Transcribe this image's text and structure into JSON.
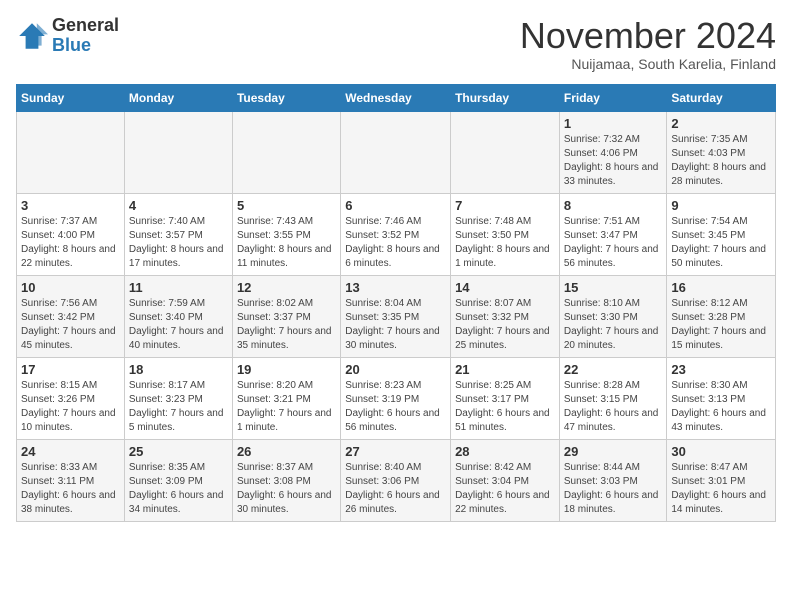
{
  "logo": {
    "general": "General",
    "blue": "Blue"
  },
  "title": "November 2024",
  "subtitle": "Nuijamaa, South Karelia, Finland",
  "days_of_week": [
    "Sunday",
    "Monday",
    "Tuesday",
    "Wednesday",
    "Thursday",
    "Friday",
    "Saturday"
  ],
  "weeks": [
    [
      {
        "day": "",
        "info": ""
      },
      {
        "day": "",
        "info": ""
      },
      {
        "day": "",
        "info": ""
      },
      {
        "day": "",
        "info": ""
      },
      {
        "day": "",
        "info": ""
      },
      {
        "day": "1",
        "info": "Sunrise: 7:32 AM\nSunset: 4:06 PM\nDaylight: 8 hours and 33 minutes."
      },
      {
        "day": "2",
        "info": "Sunrise: 7:35 AM\nSunset: 4:03 PM\nDaylight: 8 hours and 28 minutes."
      }
    ],
    [
      {
        "day": "3",
        "info": "Sunrise: 7:37 AM\nSunset: 4:00 PM\nDaylight: 8 hours and 22 minutes."
      },
      {
        "day": "4",
        "info": "Sunrise: 7:40 AM\nSunset: 3:57 PM\nDaylight: 8 hours and 17 minutes."
      },
      {
        "day": "5",
        "info": "Sunrise: 7:43 AM\nSunset: 3:55 PM\nDaylight: 8 hours and 11 minutes."
      },
      {
        "day": "6",
        "info": "Sunrise: 7:46 AM\nSunset: 3:52 PM\nDaylight: 8 hours and 6 minutes."
      },
      {
        "day": "7",
        "info": "Sunrise: 7:48 AM\nSunset: 3:50 PM\nDaylight: 8 hours and 1 minute."
      },
      {
        "day": "8",
        "info": "Sunrise: 7:51 AM\nSunset: 3:47 PM\nDaylight: 7 hours and 56 minutes."
      },
      {
        "day": "9",
        "info": "Sunrise: 7:54 AM\nSunset: 3:45 PM\nDaylight: 7 hours and 50 minutes."
      }
    ],
    [
      {
        "day": "10",
        "info": "Sunrise: 7:56 AM\nSunset: 3:42 PM\nDaylight: 7 hours and 45 minutes."
      },
      {
        "day": "11",
        "info": "Sunrise: 7:59 AM\nSunset: 3:40 PM\nDaylight: 7 hours and 40 minutes."
      },
      {
        "day": "12",
        "info": "Sunrise: 8:02 AM\nSunset: 3:37 PM\nDaylight: 7 hours and 35 minutes."
      },
      {
        "day": "13",
        "info": "Sunrise: 8:04 AM\nSunset: 3:35 PM\nDaylight: 7 hours and 30 minutes."
      },
      {
        "day": "14",
        "info": "Sunrise: 8:07 AM\nSunset: 3:32 PM\nDaylight: 7 hours and 25 minutes."
      },
      {
        "day": "15",
        "info": "Sunrise: 8:10 AM\nSunset: 3:30 PM\nDaylight: 7 hours and 20 minutes."
      },
      {
        "day": "16",
        "info": "Sunrise: 8:12 AM\nSunset: 3:28 PM\nDaylight: 7 hours and 15 minutes."
      }
    ],
    [
      {
        "day": "17",
        "info": "Sunrise: 8:15 AM\nSunset: 3:26 PM\nDaylight: 7 hours and 10 minutes."
      },
      {
        "day": "18",
        "info": "Sunrise: 8:17 AM\nSunset: 3:23 PM\nDaylight: 7 hours and 5 minutes."
      },
      {
        "day": "19",
        "info": "Sunrise: 8:20 AM\nSunset: 3:21 PM\nDaylight: 7 hours and 1 minute."
      },
      {
        "day": "20",
        "info": "Sunrise: 8:23 AM\nSunset: 3:19 PM\nDaylight: 6 hours and 56 minutes."
      },
      {
        "day": "21",
        "info": "Sunrise: 8:25 AM\nSunset: 3:17 PM\nDaylight: 6 hours and 51 minutes."
      },
      {
        "day": "22",
        "info": "Sunrise: 8:28 AM\nSunset: 3:15 PM\nDaylight: 6 hours and 47 minutes."
      },
      {
        "day": "23",
        "info": "Sunrise: 8:30 AM\nSunset: 3:13 PM\nDaylight: 6 hours and 43 minutes."
      }
    ],
    [
      {
        "day": "24",
        "info": "Sunrise: 8:33 AM\nSunset: 3:11 PM\nDaylight: 6 hours and 38 minutes."
      },
      {
        "day": "25",
        "info": "Sunrise: 8:35 AM\nSunset: 3:09 PM\nDaylight: 6 hours and 34 minutes."
      },
      {
        "day": "26",
        "info": "Sunrise: 8:37 AM\nSunset: 3:08 PM\nDaylight: 6 hours and 30 minutes."
      },
      {
        "day": "27",
        "info": "Sunrise: 8:40 AM\nSunset: 3:06 PM\nDaylight: 6 hours and 26 minutes."
      },
      {
        "day": "28",
        "info": "Sunrise: 8:42 AM\nSunset: 3:04 PM\nDaylight: 6 hours and 22 minutes."
      },
      {
        "day": "29",
        "info": "Sunrise: 8:44 AM\nSunset: 3:03 PM\nDaylight: 6 hours and 18 minutes."
      },
      {
        "day": "30",
        "info": "Sunrise: 8:47 AM\nSunset: 3:01 PM\nDaylight: 6 hours and 14 minutes."
      }
    ]
  ]
}
